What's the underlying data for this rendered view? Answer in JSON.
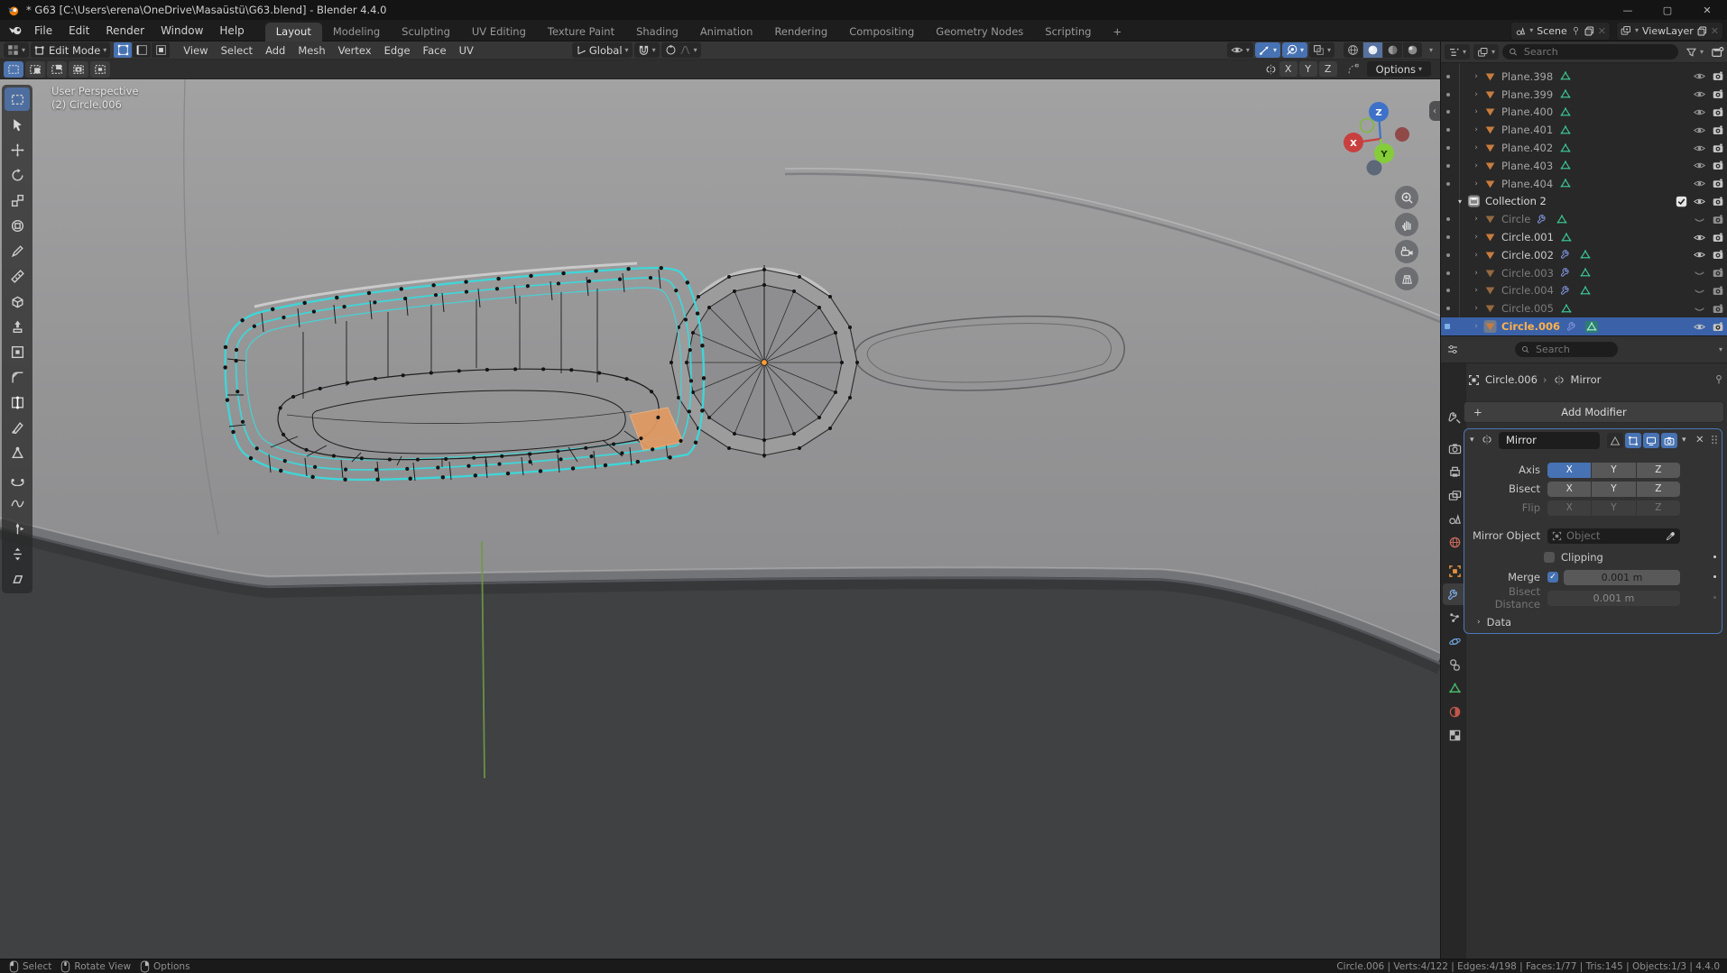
{
  "window": {
    "title": "* G63 [C:\\Users\\erena\\OneDrive\\Masaüstü\\G63.blend] - Blender 4.4.0",
    "controls": {
      "minimize": "—",
      "maximize": "▢",
      "close": "✕"
    }
  },
  "topbar": {
    "menus": [
      "File",
      "Edit",
      "Render",
      "Window",
      "Help"
    ],
    "tabs": [
      "Layout",
      "Modeling",
      "Sculpting",
      "UV Editing",
      "Texture Paint",
      "Shading",
      "Animation",
      "Rendering",
      "Compositing",
      "Geometry Nodes",
      "Scripting"
    ],
    "active_tab": "Layout",
    "new_tab": "+",
    "scene_selector": {
      "label": "Scene"
    },
    "view_layer_selector": {
      "label": "ViewLayer"
    }
  },
  "viewport": {
    "header": {
      "mode": "Edit Mode",
      "menus": [
        "View",
        "Select",
        "Add",
        "Mesh",
        "Vertex",
        "Edge",
        "Face",
        "UV"
      ],
      "orientation": "Global",
      "select_modes": [
        "vertex",
        "edge",
        "face"
      ],
      "active_select_mode": "vertex",
      "shading_modes": [
        "wireframe",
        "solid",
        "material",
        "rendered"
      ],
      "active_shading": "solid"
    },
    "tool_settings": {
      "select_box_modes": [
        "new",
        "extend",
        "subtract",
        "invert",
        "intersect"
      ],
      "mirror_axes": [
        "X",
        "Y",
        "Z"
      ],
      "options_label": "Options"
    },
    "toolbar": [
      "select-box",
      "cursor",
      "move",
      "rotate",
      "scale",
      "transform",
      "annotate",
      "measure",
      "add-cube",
      "extrude-region",
      "inset-faces",
      "bevel",
      "loop-cut",
      "knife",
      "poly-build",
      "spin",
      "smooth",
      "edge-slide",
      "shrink-fatten",
      "shear"
    ],
    "overlay": {
      "line1": "User Perspective",
      "line2": "(2) Circle.006"
    },
    "gizmo": {
      "axes": [
        "X",
        "Y",
        "Z"
      ]
    },
    "nav_buttons": [
      "zoom",
      "pan",
      "camera-view",
      "toggle-perspective"
    ]
  },
  "outliner": {
    "search_placeholder": "Search",
    "items": [
      {
        "name": "Plane.398",
        "type": "mesh",
        "tone": "dim",
        "eye": "open",
        "wrench": false
      },
      {
        "name": "Plane.399",
        "type": "mesh",
        "tone": "dim",
        "eye": "open",
        "wrench": false
      },
      {
        "name": "Plane.400",
        "type": "mesh",
        "tone": "dim",
        "eye": "open",
        "wrench": false
      },
      {
        "name": "Plane.401",
        "type": "mesh",
        "tone": "dim",
        "eye": "open",
        "wrench": false
      },
      {
        "name": "Plane.402",
        "type": "mesh",
        "tone": "dim",
        "eye": "open",
        "wrench": false
      },
      {
        "name": "Plane.403",
        "type": "mesh",
        "tone": "dim",
        "eye": "open",
        "wrench": false
      },
      {
        "name": "Plane.404",
        "type": "mesh",
        "tone": "dim",
        "eye": "open",
        "wrench": false
      },
      {
        "name": "Collection 2",
        "type": "collection",
        "tone": "bright",
        "eye": "open",
        "checkbox": true
      },
      {
        "name": "Circle",
        "type": "mesh",
        "tone": "grey",
        "eye": "closed",
        "wrench": true
      },
      {
        "name": "Circle.001",
        "type": "mesh",
        "tone": "bright",
        "eye": "open",
        "wrench": false
      },
      {
        "name": "Circle.002",
        "type": "mesh",
        "tone": "bright",
        "eye": "open",
        "wrench": true
      },
      {
        "name": "Circle.003",
        "type": "mesh",
        "tone": "grey",
        "eye": "closed",
        "wrench": true
      },
      {
        "name": "Circle.004",
        "type": "mesh",
        "tone": "grey",
        "eye": "closed",
        "wrench": true
      },
      {
        "name": "Circle.005",
        "type": "mesh",
        "tone": "grey",
        "eye": "closed",
        "wrench": false
      },
      {
        "name": "Circle.006",
        "type": "mesh",
        "tone": "selected",
        "eye": "open",
        "wrench": true,
        "selected": true
      }
    ]
  },
  "properties": {
    "search_placeholder": "Search",
    "tabs": [
      "tool",
      "render",
      "output",
      "view-layer",
      "scene",
      "world",
      "object",
      "modifiers",
      "particles",
      "physics",
      "constraints",
      "object-data",
      "material",
      "texture"
    ],
    "active_tab": "modifiers",
    "breadcrumb": {
      "object": "Circle.006",
      "separator": "›",
      "modifier": "Mirror"
    },
    "add_modifier_label": "Add Modifier",
    "modifier": {
      "name": "Mirror",
      "rows": [
        {
          "label": "Axis",
          "options": [
            "X",
            "Y",
            "Z"
          ],
          "active": [
            "X"
          ]
        },
        {
          "label": "Bisect",
          "options": [
            "X",
            "Y",
            "Z"
          ],
          "active": []
        },
        {
          "label": "Flip",
          "options": [
            "X",
            "Y",
            "Z"
          ],
          "active": [],
          "disabled": true
        }
      ],
      "mirror_object": {
        "label": "Mirror Object",
        "placeholder": "Object"
      },
      "clipping": {
        "label": "Clipping",
        "checked": false
      },
      "merge": {
        "label": "Merge",
        "checked": true,
        "value": "0.001 m"
      },
      "bisect_distance": {
        "label": "Bisect Distance",
        "value": "0.001 m",
        "disabled": true
      },
      "data_panel_label": "Data"
    }
  },
  "status_bar": {
    "hints": [
      {
        "button": "left",
        "label": "Select"
      },
      {
        "button": "middle",
        "label": "Rotate View"
      },
      {
        "button": "right",
        "label": "Options"
      }
    ],
    "stats": "Circle.006 | Verts:4/122 | Edges:4/198 | Faces:1/77 | Tris:145 | Objects:1/3 | 4.4.0"
  },
  "colors": {
    "accent": "#4772b3",
    "selection": "#3b62a8",
    "edge_select": "#3fd6d8",
    "object_orange": "#ffb14a"
  }
}
